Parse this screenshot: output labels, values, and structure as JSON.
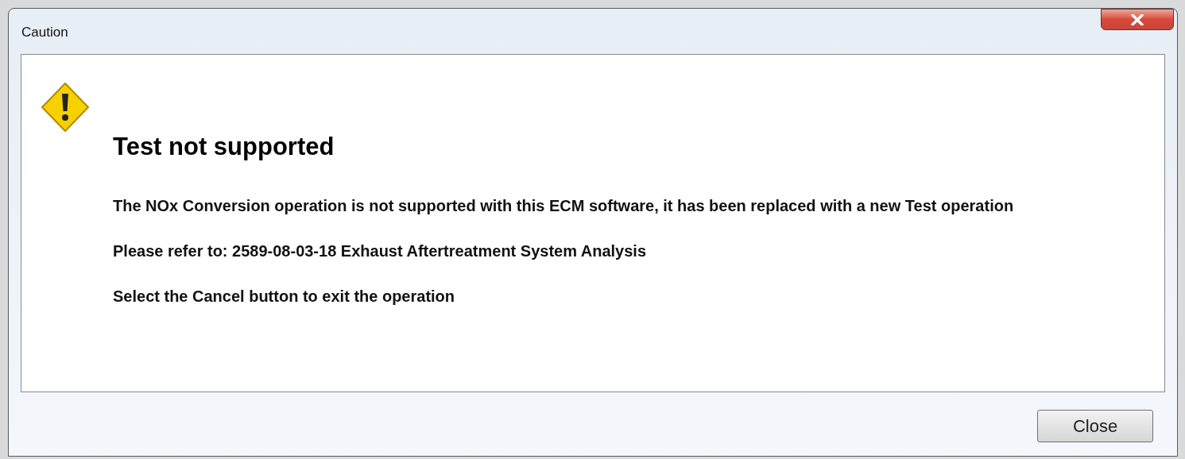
{
  "window": {
    "title": "Caution"
  },
  "message": {
    "heading": "Test not supported",
    "paragraphs": [
      "The NOx Conversion operation is not supported with this ECM software, it has been replaced with a new Test operation",
      "Please refer to: 2589-08-03-18 Exhaust Aftertreatment System Analysis",
      "Select the Cancel button to exit the operation"
    ]
  },
  "buttons": [
    "Close"
  ]
}
